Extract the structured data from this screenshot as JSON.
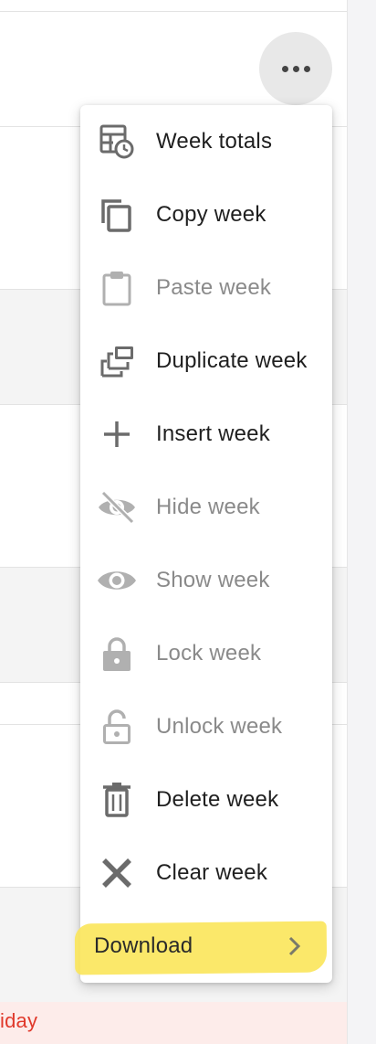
{
  "background": {
    "partial_day_label": "iday",
    "partial_day_color": "#e0392b"
  },
  "toolbar": {
    "more_button_icon": "more-horizontal-icon"
  },
  "menu": {
    "items": [
      {
        "label": "Week totals",
        "icon": "week-totals-icon",
        "enabled": true
      },
      {
        "label": "Copy week",
        "icon": "copy-icon",
        "enabled": true
      },
      {
        "label": "Paste week",
        "icon": "clipboard-icon",
        "enabled": false
      },
      {
        "label": "Duplicate week",
        "icon": "duplicate-icon",
        "enabled": true
      },
      {
        "label": "Insert week",
        "icon": "plus-icon",
        "enabled": true
      },
      {
        "label": "Hide week",
        "icon": "eye-off-icon",
        "enabled": false
      },
      {
        "label": "Show week",
        "icon": "eye-icon",
        "enabled": false
      },
      {
        "label": "Lock week",
        "icon": "lock-icon",
        "enabled": false
      },
      {
        "label": "Unlock week",
        "icon": "unlock-icon",
        "enabled": false
      },
      {
        "label": "Delete week",
        "icon": "trash-icon",
        "enabled": true
      },
      {
        "label": "Clear week",
        "icon": "close-icon",
        "enabled": true
      }
    ],
    "download": {
      "label": "Download",
      "icon": "chevron-right-icon",
      "highlight_color": "#fbe65a"
    }
  },
  "colors": {
    "enabled_text": "#1f1f1f",
    "disabled_text": "#8a8a8a",
    "enabled_icon": "#6b6b6b",
    "disabled_icon": "#b0b0b0"
  }
}
